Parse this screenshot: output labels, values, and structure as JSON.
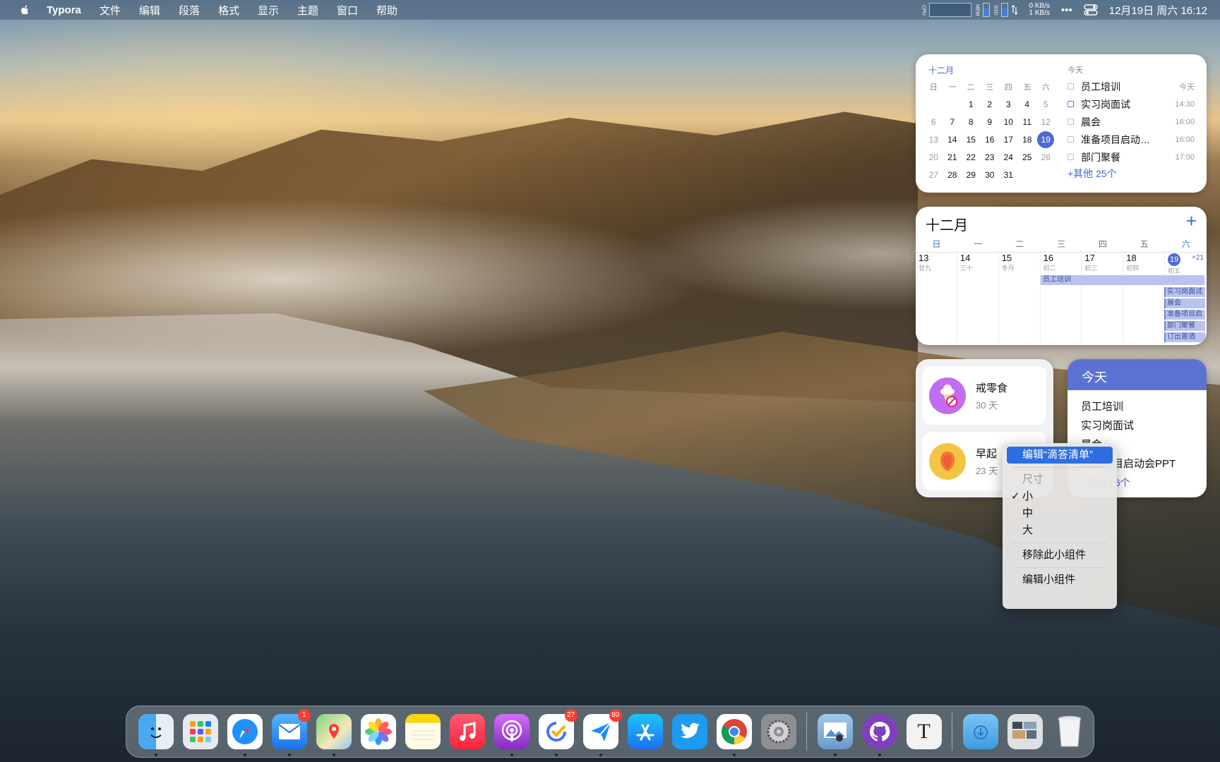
{
  "menubar": {
    "app_name": "Typora",
    "menus": [
      "文件",
      "编辑",
      "段落",
      "格式",
      "显示",
      "主题",
      "窗口",
      "帮助"
    ],
    "net_up": "0 KB/s",
    "net_down": "1 KB/s",
    "more": "•••",
    "datetime": "12月19日 周六  16:12",
    "cpu_label": "CPU",
    "mem_label": "MEM",
    "ssd_label": "SSD"
  },
  "calendar_month": {
    "month_label": "十二月",
    "weekday_headers": [
      "日",
      "一",
      "二",
      "三",
      "四",
      "五",
      "六"
    ],
    "weeks": [
      [
        "",
        "",
        "1",
        "2",
        "3",
        "4",
        "5"
      ],
      [
        "6",
        "7",
        "8",
        "9",
        "10",
        "11",
        "12"
      ],
      [
        "13",
        "14",
        "15",
        "16",
        "17",
        "18",
        "19"
      ],
      [
        "20",
        "21",
        "22",
        "23",
        "24",
        "25",
        "26"
      ],
      [
        "27",
        "28",
        "29",
        "30",
        "31",
        "",
        ""
      ]
    ],
    "today": "19",
    "events_title": "今天",
    "events": [
      {
        "title": "员工培训",
        "time": "今天"
      },
      {
        "title": "实习岗面试",
        "time": "14:30"
      },
      {
        "title": "晨会",
        "time": "16:00"
      },
      {
        "title": "准备项目启动…",
        "time": "16:00"
      },
      {
        "title": "部门聚餐",
        "time": "17:00"
      }
    ],
    "more_events": "+其他 25个"
  },
  "calendar_week": {
    "month_label": "十二月",
    "add_label": "+",
    "weekday_headers": [
      "日",
      "一",
      "二",
      "三",
      "四",
      "五",
      "六"
    ],
    "days": [
      {
        "day": "13",
        "lunar": "廿九"
      },
      {
        "day": "14",
        "lunar": "三十"
      },
      {
        "day": "15",
        "lunar": "冬月"
      },
      {
        "day": "16",
        "lunar": "初二"
      },
      {
        "day": "17",
        "lunar": "初三"
      },
      {
        "day": "18",
        "lunar": "初四"
      },
      {
        "day": "19",
        "lunar": "初五"
      }
    ],
    "extra": "+21",
    "span_event": "员工培训",
    "chips": [
      "实习岗面试",
      "晨会",
      "准备项目启",
      "部门聚餐",
      "订出差酒"
    ]
  },
  "habits": [
    {
      "name": "戒零食",
      "days": "30 天",
      "color": "#c26cf0"
    },
    {
      "name": "早起",
      "days": "23 天",
      "color": "#f4c545"
    }
  ],
  "today_widget": {
    "title": "今天",
    "items": [
      "员工培训",
      "实习岗面试",
      "晨会",
      "准备项目启动会PPT"
    ],
    "more": "+其他 26个"
  },
  "context_menu": {
    "edit_app": "编辑“滴答清单”",
    "size_header": "尺寸",
    "size_small": "小",
    "size_medium": "中",
    "size_large": "大",
    "check": "✓",
    "remove": "移除此小组件",
    "edit_widgets": "编辑小组件"
  },
  "dock": {
    "mail_badge": "1",
    "ticktick_badge": "27",
    "spark_badge": "80",
    "typora_glyph": "T"
  }
}
